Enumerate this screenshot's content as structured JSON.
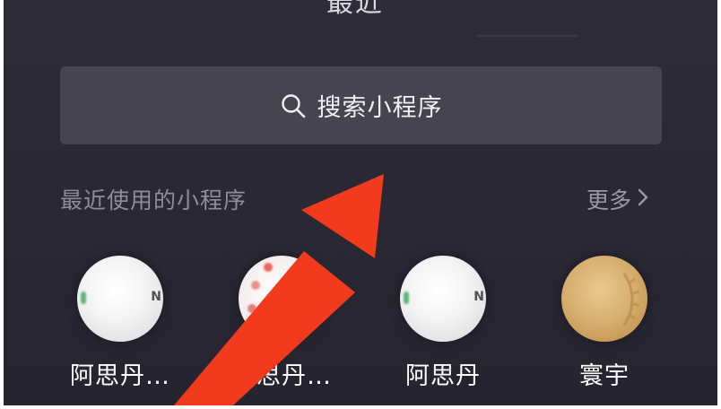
{
  "header": {
    "title_partial": "最近"
  },
  "search": {
    "placeholder": "搜索小程序",
    "icon": "search-icon"
  },
  "recent": {
    "section_title": "最近使用的小程序",
    "more_label": "更多",
    "more_icon": "chevron-right-icon",
    "apps": [
      {
        "name": "阿思丹…",
        "icon_style": "white-logo"
      },
      {
        "name": "阿思丹…",
        "icon_style": "colorful-logo"
      },
      {
        "name": "阿思丹",
        "icon_style": "white-logo"
      },
      {
        "name": "寰宇",
        "icon_style": "gold-logo"
      }
    ]
  },
  "annotation": {
    "arrow_color": "#f23a1c"
  },
  "colors": {
    "background": "#2b2935",
    "search_bar": "#46444f",
    "muted_text": "#8f8d99"
  }
}
